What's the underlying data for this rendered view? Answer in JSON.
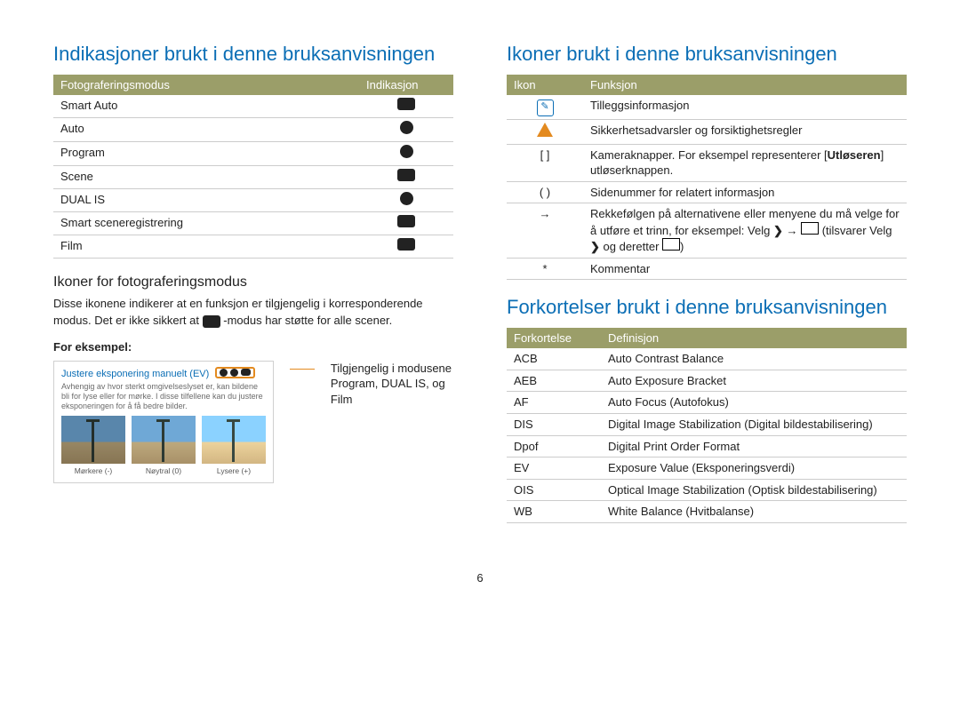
{
  "left": {
    "heading": "Indikasjoner brukt i denne bruksanvisningen",
    "table_head": {
      "c1": "Fotograferingsmodus",
      "c2": "Indikasjon"
    },
    "rows": [
      {
        "mode": "Smart Auto",
        "icon": "smart-auto-icon"
      },
      {
        "mode": "Auto",
        "icon": "auto-icon"
      },
      {
        "mode": "Program",
        "icon": "program-icon"
      },
      {
        "mode": "Scene",
        "icon": "scene-icon"
      },
      {
        "mode": "DUAL IS",
        "icon": "dual-is-icon"
      },
      {
        "mode": "Smart sceneregistrering",
        "icon": "smart-scene-icon"
      },
      {
        "mode": "Film",
        "icon": "film-icon"
      }
    ],
    "sub1": "Ikoner for fotograferingsmodus",
    "para_a": "Disse ikonene indikerer at en funksjon er tilgjengelig i korresponderende modus. Det er ikke sikkert at ",
    "para_b": "-modus har støtte for alle scener.",
    "for_eksempel": "For eksempel:",
    "example_title": "Justere eksponering manuelt (EV)",
    "example_desc": "Avhengig av hvor sterkt omgivelseslyset er, kan bildene bli for lyse eller for mørke. I disse tilfellene kan du justere eksponeringen for å få bedre bilder.",
    "thumb_labels": {
      "t1": "Mørkere (-)",
      "t2": "Nøytral (0)",
      "t3": "Lysere (+)"
    },
    "callout": "Tilgjengelig i modusene Program, DUAL IS, og Film"
  },
  "right": {
    "heading1": "Ikoner brukt i denne bruksanvisningen",
    "icons_head": {
      "c1": "Ikon",
      "c2": "Funksjon"
    },
    "icons_rows": {
      "r1": "Tilleggsinformasjon",
      "r2": "Sikkerhetsadvarsler og forsiktighetsregler",
      "r3a": "Kameraknapper. For eksempel representerer [",
      "r3b": "Utløseren",
      "r3c": "] utløserknappen.",
      "r3_icon": "[ ]",
      "r4_icon": "( )",
      "r4": "Sidenummer for relatert informasjon",
      "r5_icon": "→",
      "r5a": "Rekkefølgen på alternativene eller menyene du må velge for å utføre et trinn, for eksempel: Velg ",
      "r5b": " → ",
      "r5c": " (tilsvarer Velg ",
      "r5d": " og deretter ",
      "r5e": ")",
      "r6_icon": "*",
      "r6": "Kommentar"
    },
    "heading2": "Forkortelser brukt i denne bruksanvisningen",
    "abbr_head": {
      "c1": "Forkortelse",
      "c2": "Definisjon"
    },
    "abbr_rows": [
      {
        "a": "ACB",
        "d": "Auto Contrast Balance"
      },
      {
        "a": "AEB",
        "d": "Auto Exposure Bracket"
      },
      {
        "a": "AF",
        "d": "Auto Focus (Autofokus)"
      },
      {
        "a": "DIS",
        "d": "Digital Image Stabilization (Digital bildestabilisering)"
      },
      {
        "a": "Dpof",
        "d": "Digital Print Order Format"
      },
      {
        "a": "EV",
        "d": "Exposure Value (Eksponeringsverdi)"
      },
      {
        "a": "OIS",
        "d": "Optical Image Stabilization (Optisk bildestabilisering)"
      },
      {
        "a": "WB",
        "d": "White Balance (Hvitbalanse)"
      }
    ]
  },
  "page_number": "6"
}
